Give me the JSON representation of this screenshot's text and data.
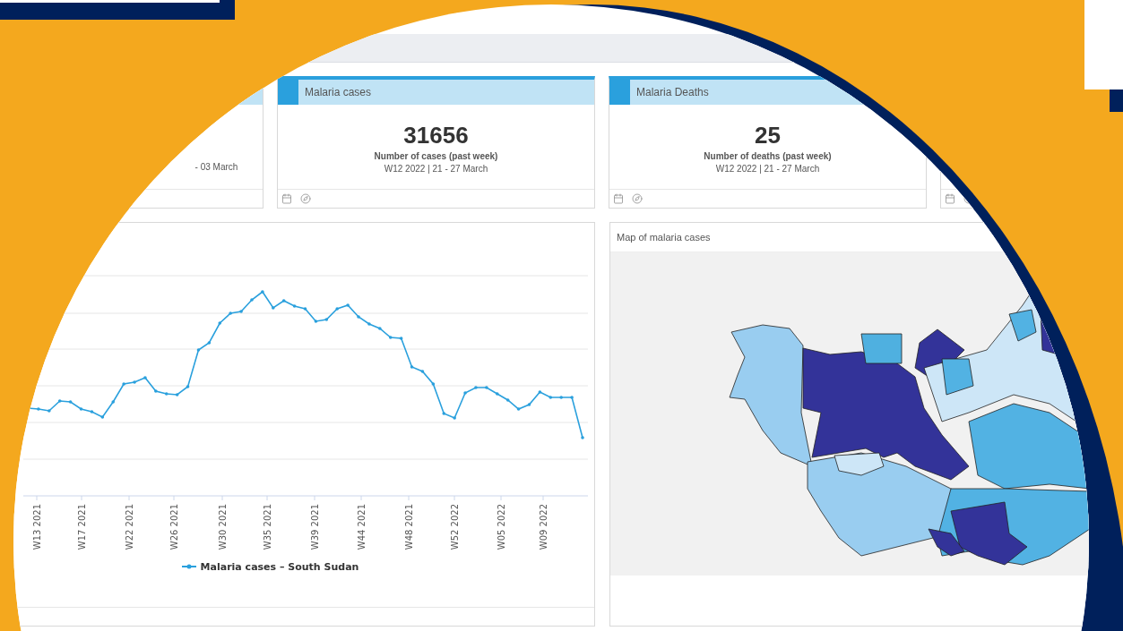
{
  "cards": [
    {
      "kind": "partial",
      "date": "- 03 March"
    },
    {
      "kind": "full",
      "title": "Malaria cases",
      "value": "31656",
      "label": "Number of cases (past week)",
      "date": "W12 2022 | 21 - 27 March"
    },
    {
      "kind": "full",
      "title": "Malaria Deaths",
      "value": "25",
      "label": "Number of deaths (past week)",
      "date": "W12 2022 | 21 - 27 March"
    },
    {
      "kind": "stub"
    }
  ],
  "trend_chart": {
    "x_labels": [
      "W13 2021",
      "W17 2021",
      "W22 2021",
      "W26 2021",
      "W30 2021",
      "W35 2021",
      "W39 2021",
      "W44 2021",
      "W48 2021",
      "W52 2022",
      "W05 2022",
      "W09 2022"
    ],
    "legend": "Malaria cases – South Sudan"
  },
  "map": {
    "title": "Map of malaria cases"
  }
}
